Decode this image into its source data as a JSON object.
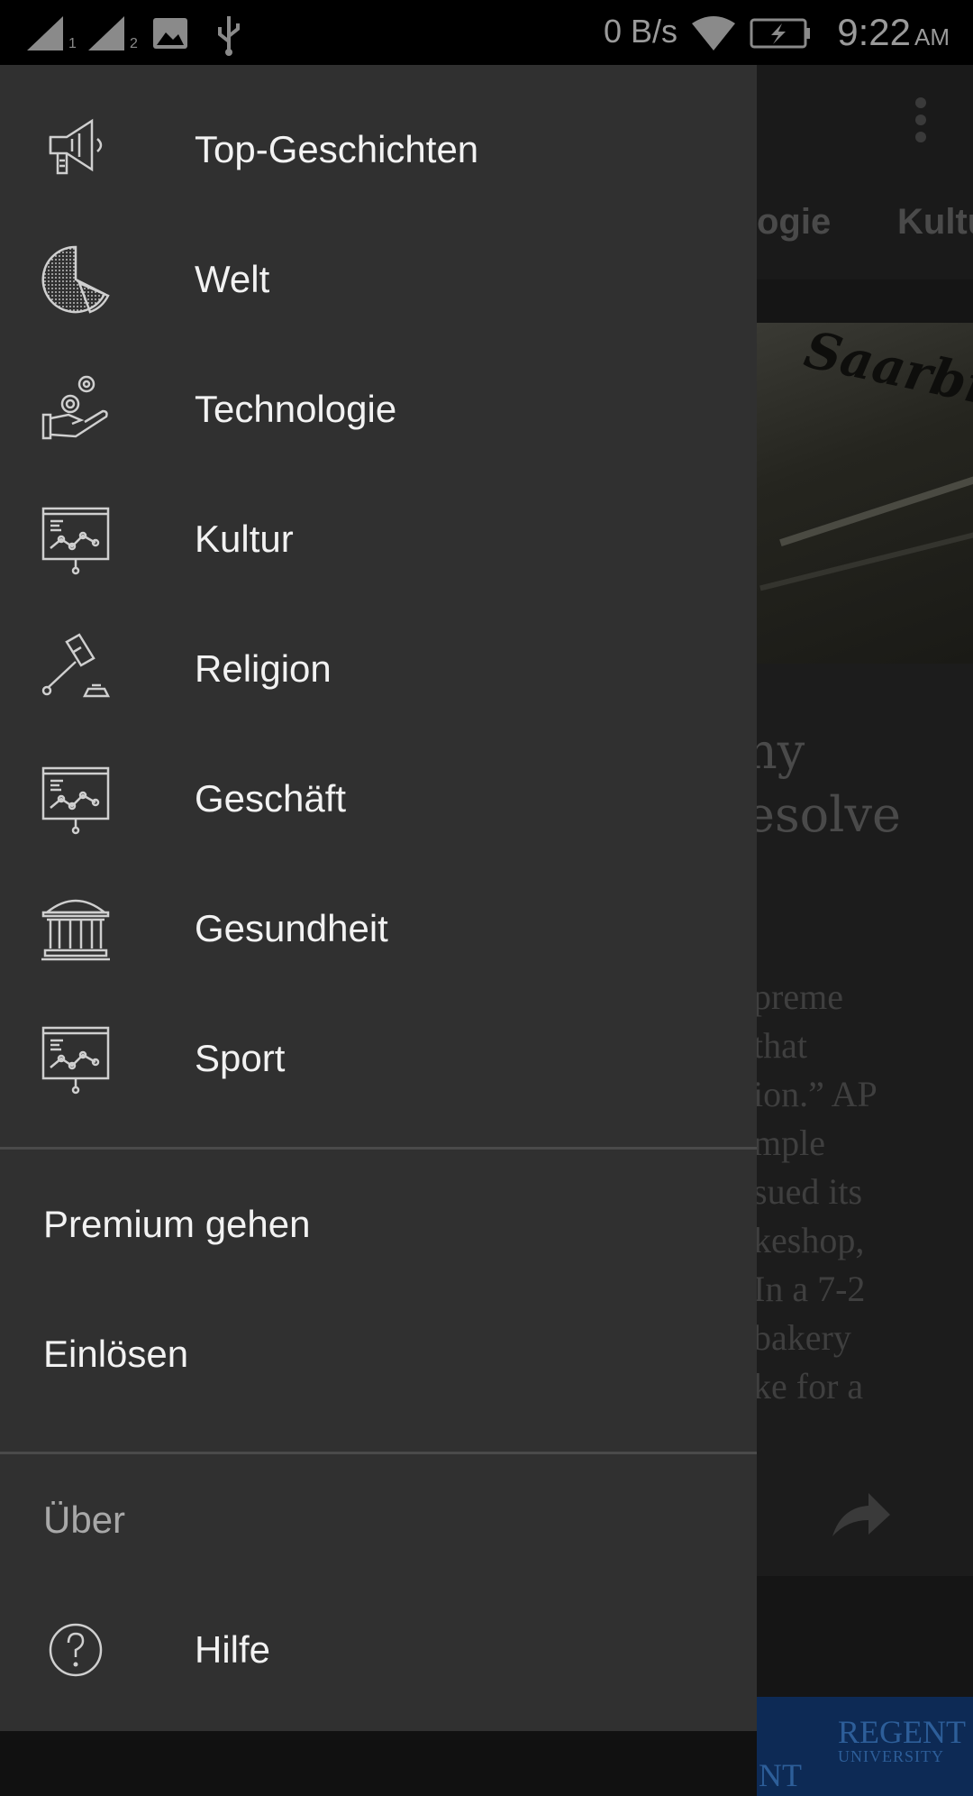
{
  "status_bar": {
    "network_speed": "0 B/s",
    "time": "9:22",
    "ampm": "AM",
    "sim_labels": [
      "1",
      "2"
    ],
    "icons": [
      "signal-sim1-icon",
      "signal-sim2-icon",
      "image-icon",
      "usb-icon",
      "wifi-icon",
      "battery-charging-icon"
    ]
  },
  "drawer": {
    "categories": [
      {
        "label": "Top-Geschichten",
        "icon": "megaphone-icon"
      },
      {
        "label": "Welt",
        "icon": "globe-pie-icon"
      },
      {
        "label": "Technologie",
        "icon": "hand-coins-icon"
      },
      {
        "label": "Kultur",
        "icon": "presentation-chart-icon"
      },
      {
        "label": "Religion",
        "icon": "gavel-icon"
      },
      {
        "label": "Geschäft",
        "icon": "presentation-chart-icon"
      },
      {
        "label": "Gesundheit",
        "icon": "courthouse-icon"
      },
      {
        "label": "Sport",
        "icon": "presentation-chart-icon"
      }
    ],
    "premium_label": "Premium gehen",
    "redeem_label": "Einlösen",
    "about_label": "Über",
    "help_label": "Hilfe",
    "help_icon": "question-circle-icon"
  },
  "background": {
    "tabs": [
      "ogie",
      "Kultu"
    ],
    "headline_lines": [
      "ny",
      "esolve"
    ],
    "body_lines": [
      "preme",
      "that",
      "ion.” AP",
      "mple",
      "sued its",
      "keshop,",
      " In a 7-2",
      "bakery",
      "ke for a"
    ],
    "ad_title": "REGENT",
    "ad_subtitle": "UNIVERSITY",
    "ad_fragment": "NT"
  },
  "colors": {
    "drawer_bg": "#303030",
    "status_bar_bg": "#000000",
    "label_text": "#f2f2f2",
    "section_label": "#a8a8a8",
    "icon_stroke": "#cfcfcf"
  }
}
